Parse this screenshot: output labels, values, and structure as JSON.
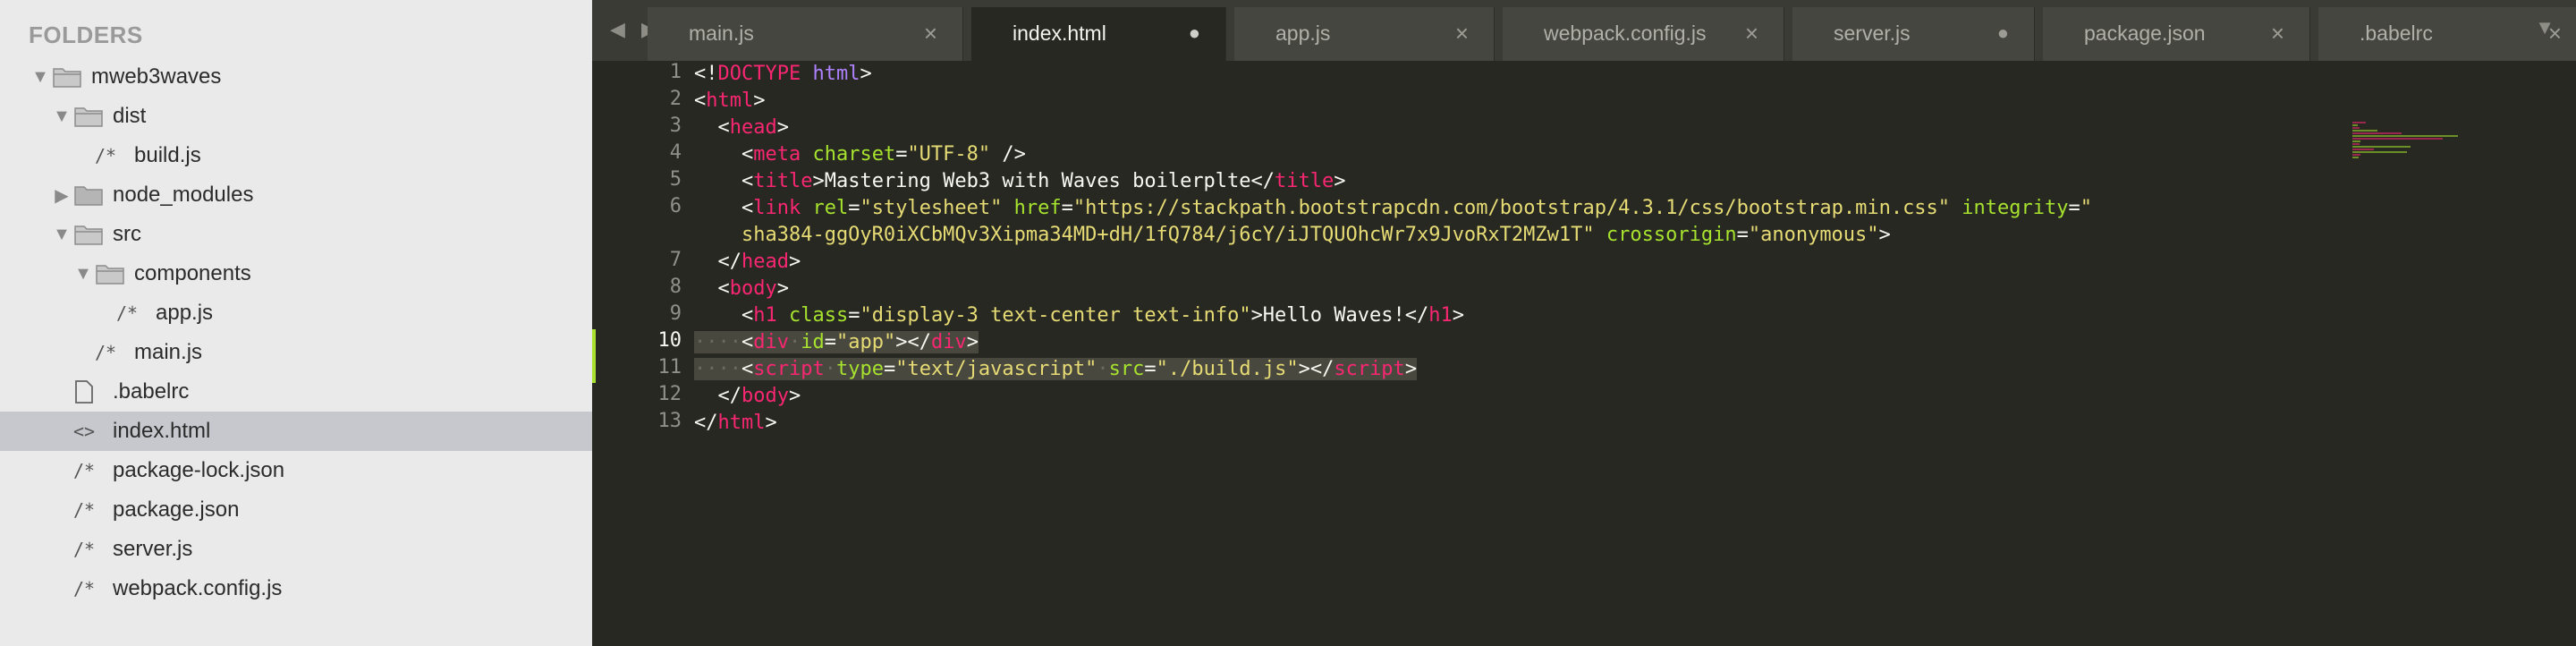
{
  "sidebar": {
    "title": "FOLDERS",
    "items": [
      {
        "label": "mweb3waves",
        "type": "folder-open"
      },
      {
        "label": "dist",
        "type": "folder-open"
      },
      {
        "label": "build.js",
        "type": "file-js",
        "glyph": "/*"
      },
      {
        "label": "node_modules",
        "type": "folder-closed"
      },
      {
        "label": "src",
        "type": "folder-open"
      },
      {
        "label": "components",
        "type": "folder-open"
      },
      {
        "label": "app.js",
        "type": "file-js",
        "glyph": "/*"
      },
      {
        "label": "main.js",
        "type": "file-js",
        "glyph": "/*"
      },
      {
        "label": ".babelrc",
        "type": "file-plain"
      },
      {
        "label": "index.html",
        "type": "file-html",
        "glyph": "<>",
        "selected": true
      },
      {
        "label": "package-lock.json",
        "type": "file-js",
        "glyph": "/*"
      },
      {
        "label": "package.json",
        "type": "file-js",
        "glyph": "/*"
      },
      {
        "label": "server.js",
        "type": "file-js",
        "glyph": "/*"
      },
      {
        "label": "webpack.config.js",
        "type": "file-js",
        "glyph": "/*"
      }
    ]
  },
  "tabs": [
    {
      "label": "main.js",
      "indicator": "×"
    },
    {
      "label": "index.html",
      "indicator": "●",
      "active": true
    },
    {
      "label": "app.js",
      "indicator": "×"
    },
    {
      "label": "webpack.config.js",
      "indicator": "×"
    },
    {
      "label": "server.js",
      "indicator": "●"
    },
    {
      "label": "package.json",
      "indicator": "×"
    },
    {
      "label": ".babelrc",
      "indicator": "×"
    }
  ],
  "nav": {
    "back": "◀",
    "forward": "▶",
    "overflow": "▼"
  },
  "editor": {
    "current_line": 10,
    "line_numbers": [
      "1",
      "2",
      "3",
      "4",
      "5",
      "6",
      "",
      "7",
      "8",
      "9",
      "10",
      "11",
      "12",
      "13"
    ],
    "lines": [
      [
        [
          "p",
          "<!"
        ],
        [
          "t",
          "DOCTYPE"
        ],
        [
          "p",
          " "
        ],
        [
          "d",
          "html"
        ],
        [
          "p",
          ">"
        ]
      ],
      [
        [
          "p",
          "<"
        ],
        [
          "t",
          "html"
        ],
        [
          "p",
          ">"
        ]
      ],
      [
        [
          "p",
          "  <"
        ],
        [
          "t",
          "head"
        ],
        [
          "p",
          ">"
        ]
      ],
      [
        [
          "p",
          "    <"
        ],
        [
          "t",
          "meta"
        ],
        [
          "p",
          " "
        ],
        [
          "a",
          "charset"
        ],
        [
          "p",
          "="
        ],
        [
          "s",
          "\"UTF-8\""
        ],
        [
          "p",
          " />"
        ]
      ],
      [
        [
          "p",
          "    <"
        ],
        [
          "t",
          "title"
        ],
        [
          "p",
          ">Mastering Web3 with Waves boilerplte</"
        ],
        [
          "t",
          "title"
        ],
        [
          "p",
          ">"
        ]
      ],
      [
        [
          "p",
          "    <"
        ],
        [
          "t",
          "link"
        ],
        [
          "p",
          " "
        ],
        [
          "a",
          "rel"
        ],
        [
          "p",
          "="
        ],
        [
          "s",
          "\"stylesheet\""
        ],
        [
          "p",
          " "
        ],
        [
          "a",
          "href"
        ],
        [
          "p",
          "="
        ],
        [
          "s",
          "\"https://stackpath.bootstrapcdn.com/bootstrap/4.3.1/css/bootstrap.min.css\""
        ],
        [
          "p",
          " "
        ],
        [
          "a",
          "integrity"
        ],
        [
          "p",
          "="
        ],
        [
          "s",
          "\""
        ]
      ],
      [
        [
          "s",
          "    sha384-ggOyR0iXCbMQv3Xipma34MD+dH/1fQ784/j6cY/iJTQUOhcWr7x9JvoRxT2MZw1T\""
        ],
        [
          "p",
          " "
        ],
        [
          "a",
          "crossorigin"
        ],
        [
          "p",
          "="
        ],
        [
          "s",
          "\"anonymous\""
        ],
        [
          "p",
          ">"
        ]
      ],
      [
        [
          "p",
          "  </"
        ],
        [
          "t",
          "head"
        ],
        [
          "p",
          ">"
        ]
      ],
      [
        [
          "p",
          "  <"
        ],
        [
          "t",
          "body"
        ],
        [
          "p",
          ">"
        ]
      ],
      [
        [
          "p",
          "    <"
        ],
        [
          "t",
          "h1"
        ],
        [
          "p",
          " "
        ],
        [
          "a",
          "class"
        ],
        [
          "p",
          "="
        ],
        [
          "s",
          "\"display-3 text-center text-info\""
        ],
        [
          "p",
          ">Hello Waves!</"
        ],
        [
          "t",
          "h1"
        ],
        [
          "p",
          ">"
        ]
      ],
      [
        [
          "ws",
          "····"
        ],
        [
          "p",
          "<"
        ],
        [
          "t",
          "div"
        ],
        [
          "ws",
          "·"
        ],
        [
          "a",
          "id"
        ],
        [
          "p",
          "="
        ],
        [
          "s",
          "\"app\""
        ],
        [
          "p",
          "></"
        ],
        [
          "t",
          "div"
        ],
        [
          "p",
          ">"
        ]
      ],
      [
        [
          "ws",
          "····"
        ],
        [
          "p",
          "<"
        ],
        [
          "t",
          "script"
        ],
        [
          "ws",
          "·"
        ],
        [
          "a",
          "type"
        ],
        [
          "p",
          "="
        ],
        [
          "s",
          "\"text/javascript\""
        ],
        [
          "ws",
          "·"
        ],
        [
          "a",
          "src"
        ],
        [
          "p",
          "="
        ],
        [
          "s",
          "\"./build.js\""
        ],
        [
          "p",
          "></"
        ],
        [
          "t",
          "script"
        ],
        [
          "p",
          ">"
        ]
      ],
      [
        [
          "p",
          "  </"
        ],
        [
          "t",
          "body"
        ],
        [
          "p",
          ">"
        ]
      ],
      [
        [
          "p",
          "</"
        ],
        [
          "t",
          "html"
        ],
        [
          "p",
          ">"
        ]
      ]
    ]
  }
}
